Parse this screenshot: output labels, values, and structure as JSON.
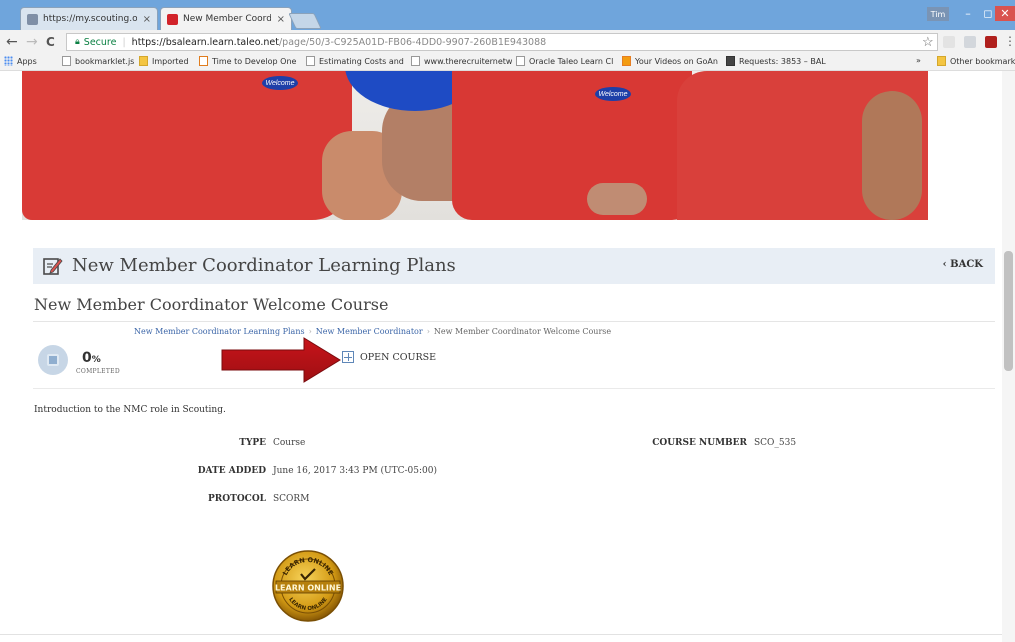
{
  "browser": {
    "tabs": [
      {
        "label": "https://my.scouting.org",
        "close": "×",
        "favicon_color": "#7f8fa6"
      },
      {
        "label": "New Member Coordinat",
        "close": "×",
        "favicon_color": "#d2232a"
      }
    ],
    "window_user": "Tim",
    "window_controls": {
      "minimize": "–",
      "maximize": "◻",
      "close": "✕"
    },
    "nav": {
      "back": "←",
      "forward": "→",
      "reload": "C"
    },
    "address": {
      "secure_label": "Secure",
      "host": "https://bsalearn.learn.taleo.net",
      "path": "/page/50/3-C925A01D-FB06-4DD0-9907-260B1E943088"
    },
    "star": "☆",
    "bookmarks": [
      {
        "label": "Apps",
        "icon": "apps-icon"
      },
      {
        "label": "bookmarklet.js",
        "icon": "page-icon"
      },
      {
        "label": "Imported",
        "icon": "folder-icon"
      },
      {
        "label": "Time to Develop One",
        "icon": "site-icon"
      },
      {
        "label": "Estimating Costs and",
        "icon": "page-icon"
      },
      {
        "label": "www.therecruiternetw",
        "icon": "page-icon"
      },
      {
        "label": "Oracle Taleo Learn Cl",
        "icon": "page-icon"
      },
      {
        "label": "Your Videos on GoAn",
        "icon": "goanimate-icon"
      },
      {
        "label": "Requests: 3853 – BAL",
        "icon": "p-icon"
      }
    ],
    "bookmarks_overflow": "»",
    "other_bookmarks": "Other bookmarks"
  },
  "hero": {
    "badge_text": "Welcome"
  },
  "learning_plan": {
    "title": "New Member Coordinator Learning Plans",
    "back_label": "‹ BACK"
  },
  "course": {
    "title": "New Member Coordinator Welcome Course",
    "breadcrumb": [
      "New Member Coordinator Learning Plans",
      "New Member Coordinator",
      "New Member Coordinator Welcome Course"
    ],
    "breadcrumb_divider": "›",
    "progress": {
      "value": "0",
      "unit": "%",
      "label": "COMPLETED",
      "fraction": 0
    },
    "open_label": "OPEN COURSE",
    "description": "Introduction to the NMC role in Scouting.",
    "details": {
      "type_label": "TYPE",
      "type_value": "Course",
      "date_label": "DATE ADDED",
      "date_value": "June 16, 2017 3:43 PM (UTC-05:00)",
      "protocol_label": "PROTOCOL",
      "protocol_value": "SCORM",
      "number_label": "COURSE NUMBER",
      "number_value": "SCO_535"
    },
    "seal_text": {
      "arc_top": "LEARN ONLINE",
      "center": "LEARN ONLINE",
      "arc_bottom": "LEARN ONLINE"
    }
  },
  "colors": {
    "accent_red": "#c0161b",
    "link_blue": "#3c66a8",
    "header_band": "#e8eef5"
  }
}
